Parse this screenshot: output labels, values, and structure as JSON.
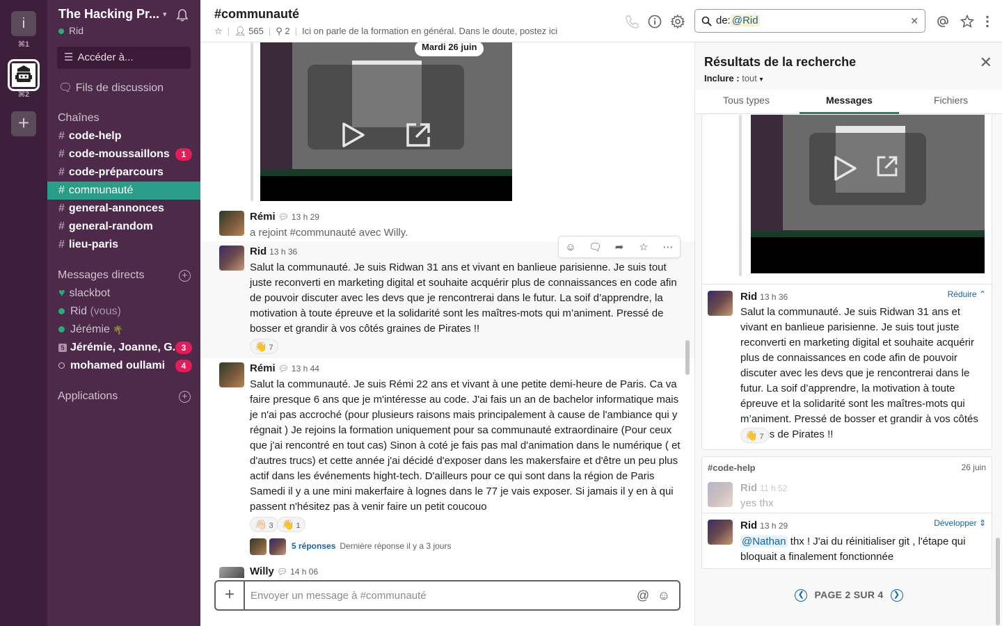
{
  "workspaces": {
    "first_initial": "i",
    "first_shortcut": "⌘1",
    "second_shortcut": "⌘2",
    "add_label": "+"
  },
  "sidebar": {
    "team_name": "The Hacking Pr...",
    "user_name": "Rid",
    "jump_label": "Accéder à...",
    "threads_label": "Fils de discussion",
    "channels_header": "Chaînes",
    "channels": [
      {
        "name": "code-help",
        "bold": true,
        "badge": ""
      },
      {
        "name": "code-moussaillons",
        "bold": true,
        "badge": "1"
      },
      {
        "name": "code-préparcours",
        "bold": true,
        "badge": ""
      },
      {
        "name": "communauté",
        "active": true,
        "badge": ""
      },
      {
        "name": "general-annonces",
        "bold": true,
        "badge": ""
      },
      {
        "name": "general-random",
        "bold": true,
        "badge": ""
      },
      {
        "name": "lieu-paris",
        "bold": true,
        "badge": ""
      }
    ],
    "dm_header": "Messages directs",
    "dms": [
      {
        "name": "slackbot",
        "suffix": "",
        "badge": ""
      },
      {
        "name": "Rid",
        "suffix": "(vous)",
        "badge": ""
      },
      {
        "name": "Jérémie",
        "suffix": "🌴",
        "badge": ""
      },
      {
        "name": "Jérémie, Joanne, G...",
        "group_count": "5",
        "badge": "3"
      },
      {
        "name": "mohamed oullami",
        "badge": "4"
      }
    ],
    "apps_header": "Applications"
  },
  "channel": {
    "title": "#communauté",
    "members": "565",
    "pins": "2",
    "topic": "Ici on parle de la formation en général. Dans le doute, postez ici"
  },
  "search": {
    "prefix": "de:",
    "mention": "@Rid"
  },
  "messages": {
    "date_divider": "Mardi 26 juin",
    "m1": {
      "author": "Rémi",
      "time": "13 h 29",
      "text": "a rejoint #communauté avec Willy."
    },
    "m2": {
      "author": "Rid",
      "time": "13 h 36",
      "text": "Salut la communauté. Je suis Ridwan 31 ans et vivant en banlieue parisienne. Je suis tout juste reconverti en marketing digital et souhaite acquérir plus de connaissances en code afin de pouvoir discuter avec les devs que je rencontrerai dans le futur. La soif d’apprendre, la motivation à toute épreuve et la solidarité sont les maîtres-mots qui m’animent. Pressé de bosser et grandir à vos côtés graines de Pirates !!",
      "reaction_emoji": "👋",
      "reaction_count": "7"
    },
    "m3": {
      "author": "Rémi",
      "time": "13 h 44",
      "text": "Salut la communauté. Je suis Rémi 22 ans et vivant à une petite demi-heure de Paris. Ca va faire presque 6 ans que je m'intéresse au code. J'ai fais un an de bachelor informatique mais je n'ai pas accroché (pour plusieurs raisons mais principalement à cause de l'ambiance qui y régnait ) Je rejoins la formation uniquement pour sa communauté extraordinaire (Pour ceux que j'ai rencontré en tout cas) Sinon à coté je fais pas mal d'animation dans le numérique ( et d'autres trucs) et cette année j'ai décidé d'exposer dans les makersfaire et d'être un peu plus actif dans les événements hight-tech. D'ailleurs pour ce qui sont dans la région de Paris Samedi il y a une mini makerfaire à lognes dans le 77 je vais exposer. Si jamais il y en à qui passent n'hésitez pas à venir faire un petit coucouo",
      "reaction1_emoji": "👋🏻",
      "reaction1_count": "3",
      "reaction2_emoji": "👋",
      "reaction2_count": "1",
      "replies": "5 réponses",
      "last_reply": "Dernière réponse il y a 3 jours"
    },
    "m4": {
      "author": "Willy",
      "time": "14 h 06"
    }
  },
  "composer": {
    "placeholder": "Envoyer un message à #communauté"
  },
  "panel": {
    "title": "Résultats de la recherche",
    "include_label": "Inclure :",
    "include_value": "tout",
    "tabs": [
      "Tous types",
      "Messages",
      "Fichiers"
    ],
    "active_tab": 1,
    "r1": {
      "author": "Rid",
      "time": "13 h 36",
      "toggle": "Réduire",
      "text": "Salut la communauté. Je suis Ridwan 31 ans et vivant en banlieue parisienne. Je suis tout juste reconverti en marketing digital et souhaite acquérir plus de connaissances en code afin de pouvoir discuter avec les devs que je rencontrerai dans le futur. La soif d’apprendre, la motivation à toute épreuve et la solidarité sont les maîtres-mots qui m’animent. Pressé de bosser et grandir à vos côtés graines de Pirates !!",
      "reaction_emoji": "👋",
      "reaction_count": "7"
    },
    "r2": {
      "channel": "#code-help",
      "date": "26 juin",
      "ctx_author": "Rid",
      "ctx_time": "11 h 52",
      "ctx_text": "yes thx",
      "author": "Rid",
      "time": "13 h 29",
      "toggle": "Développer",
      "mention": "@Nathan",
      "text": " thx ! J'ai du réinitialiser git , l'étape qui bloquait a finalement fonctionnée"
    },
    "pager": "PAGE 2 SUR 4"
  },
  "colors": {
    "rail": "#3d1f3b",
    "sidebar": "#4d2a4a",
    "active_channel": "#2a9d88",
    "badge": "#e01e5a",
    "link": "#1264a3",
    "tab_underline": "#1a8a5c"
  }
}
